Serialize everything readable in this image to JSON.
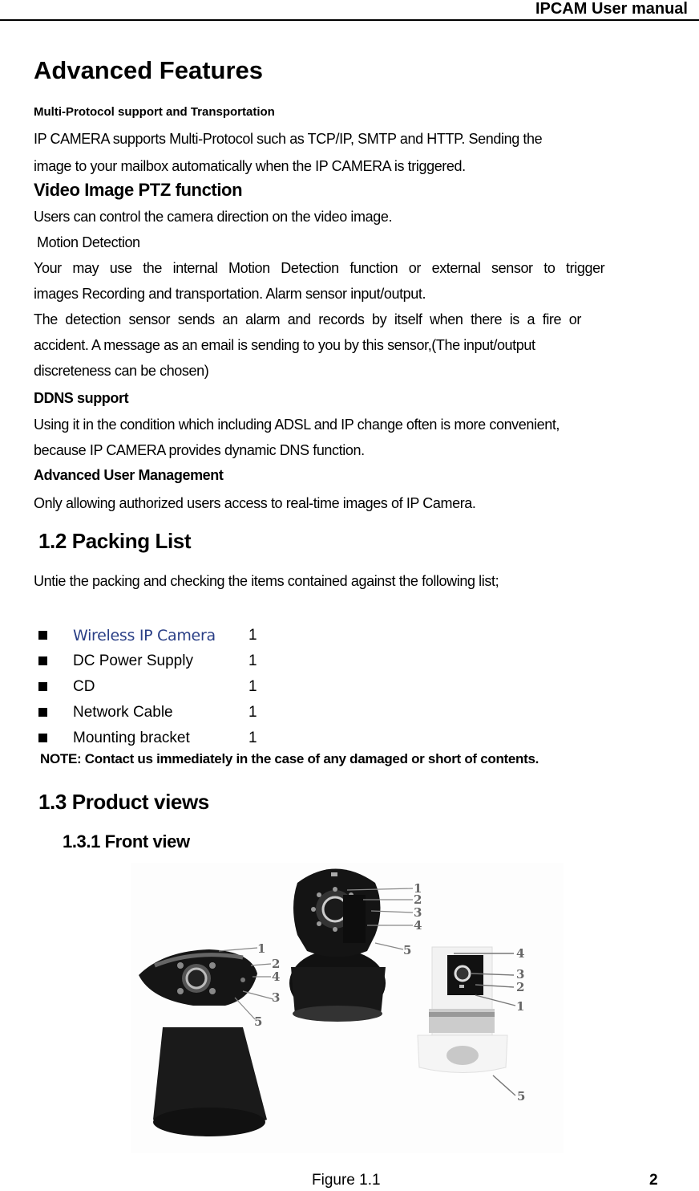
{
  "header": {
    "title": "IPCAM User manual"
  },
  "advanced": {
    "title": "Advanced Features",
    "multi_protocol": {
      "heading": "Multi-Protocol support and Transportation",
      "line1": "IP CAMERA supports Multi-Protocol such as TCP/IP, SMTP and HTTP. Sending the",
      "line2": "image to your mailbox automatically when the IP CAMERA is triggered."
    },
    "ptz": {
      "heading": "Video Image PTZ function",
      "text": "Users can control the camera direction on the video image."
    },
    "motion": {
      "heading": "Motion Detection",
      "line1": "Your may use the internal Motion Detection function or external sensor to trigger",
      "line2": "images Recording and transportation. Alarm sensor input/output.",
      "line3": "The detection sensor sends an alarm and records by itself when there is a fire or",
      "line4": "accident. A message as an email is sending to you by this sensor,(The input/output",
      "line5": "discreteness can be chosen)"
    },
    "ddns": {
      "heading": "DDNS support",
      "line1": "Using it in the condition which including ADSL and IP change often is more convenient,",
      "line2": "because IP CAMERA provides dynamic DNS function."
    },
    "user_mgmt": {
      "heading": "Advanced User Management",
      "text": "Only allowing authorized users access to real-time images of IP Camera."
    }
  },
  "packing": {
    "title": "1.2 Packing List",
    "intro": "Untie the packing and checking the items contained against the following list;",
    "items": [
      {
        "name": "Wireless IP Camera",
        "qty": "1"
      },
      {
        "name": "DC Power Supply",
        "qty": "1"
      },
      {
        "name": "CD",
        "qty": "1"
      },
      {
        "name": "Network Cable",
        "qty": "1"
      },
      {
        "name": "Mounting bracket",
        "qty": "1"
      }
    ],
    "note": "NOTE: Contact us immediately in the case of any damaged or short of contents."
  },
  "product_views": {
    "title": "1.3 Product views",
    "front_view_title": "1.3.1 Front view",
    "figure": {
      "description": "Three IP cameras with numbered callouts",
      "camera_left_callouts": [
        "1",
        "2",
        "4",
        "3",
        "5"
      ],
      "camera_center_callouts": [
        "1",
        "2",
        "3",
        "4",
        "5"
      ],
      "camera_right_callouts": [
        "4",
        "3",
        "2",
        "1",
        "5"
      ]
    },
    "caption": "Figure 1.1"
  },
  "footer": {
    "page_number": "2"
  }
}
